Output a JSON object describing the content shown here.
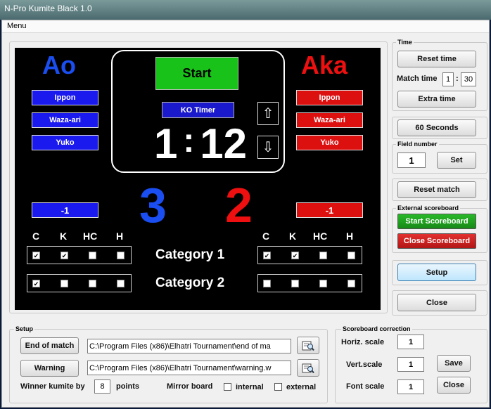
{
  "window": {
    "title": "N-Pro Kumite Black 1.0",
    "menu": "Menu"
  },
  "scoreboard": {
    "start_label": "Start",
    "ko_timer_label": "KO Timer",
    "timer": {
      "minutes": "1",
      "separator": ":",
      "seconds": "12"
    },
    "up_arrow": "⇧",
    "down_arrow": "⇩",
    "blue": {
      "name": "Ao",
      "score": "3",
      "ippon": "Ippon",
      "waza_ari": "Waza-ari",
      "yuko": "Yuko",
      "minus": "-1"
    },
    "red": {
      "name": "Aka",
      "score": "2",
      "ippon": "Ippon",
      "waza_ari": "Waza-ari",
      "yuko": "Yuko",
      "minus": "-1"
    },
    "penalty_headers": [
      "C",
      "K",
      "HC",
      "H"
    ],
    "categories": [
      "Category 1",
      "Category 2"
    ],
    "blue_penalties": [
      [
        true,
        true,
        false,
        false
      ],
      [
        true,
        false,
        false,
        false
      ]
    ],
    "red_penalties": [
      [
        true,
        true,
        false,
        false
      ],
      [
        false,
        false,
        false,
        false
      ]
    ],
    "colors": {
      "blue": "#1a1aee",
      "red": "#dd1010",
      "green": "#19c219",
      "board": "#000000"
    }
  },
  "right": {
    "time_group": "Time",
    "reset_time": "Reset time",
    "match_time_label": "Match time",
    "match_time_min": "1",
    "match_time_sep": ":",
    "match_time_sec": "30",
    "extra_time": "Extra time",
    "sixty_seconds": "60 Seconds",
    "field_number_group": "Field number",
    "field_number": "1",
    "set": "Set",
    "reset_match": "Reset match",
    "external_group": "External scoreboard",
    "start_scoreboard": "Start Scoreboard",
    "close_scoreboard": "Close Scoreboard",
    "setup": "Setup",
    "close": "Close"
  },
  "setup": {
    "group": "Setup",
    "end_of_match": "End of match",
    "end_of_match_path": "C:\\Program Files (x86)\\Elhatri Tournament\\end of ma",
    "warning": "Warning",
    "warning_path": "C:\\Program Files (x86)\\Elhatri Tournament\\warning.w",
    "winner_label": "Winner kumite by",
    "winner_points": "8",
    "points_label": "points",
    "mirror_label": "Mirror board",
    "internal": "internal",
    "external": "external"
  },
  "correction": {
    "group": "Scoreboard correction",
    "horiz_label": "Horiz. scale",
    "horiz_value": "1",
    "vert_label": "Vert.scale",
    "vert_value": "1",
    "font_label": "Font scale",
    "font_value": "1",
    "save": "Save",
    "close": "Close"
  }
}
